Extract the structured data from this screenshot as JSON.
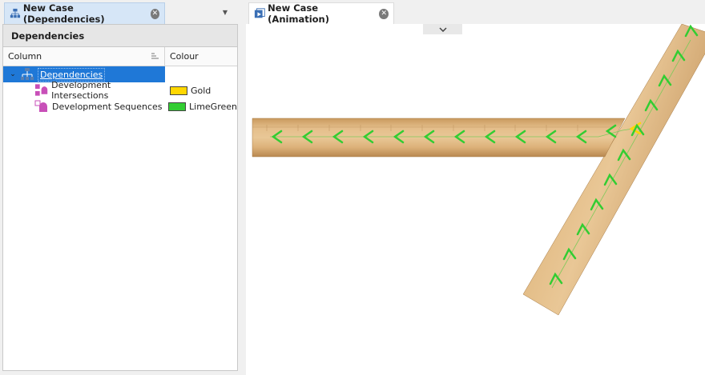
{
  "left_tab": {
    "title": "New Case (Dependencies)",
    "icon": "dependencies-tab-icon",
    "close_icon": "close-icon"
  },
  "right_tab": {
    "title": "New Case (Animation)",
    "icon": "animation-tab-icon",
    "close_icon": "close-icon"
  },
  "panel": {
    "title": "Dependencies",
    "columns": {
      "column": "Column",
      "colour": "Colour"
    },
    "rows": [
      {
        "label": "Dependencies",
        "colour_name": "",
        "icon": "hierarchy-icon",
        "selected": true,
        "expanded": true
      },
      {
        "label": "Development Intersections",
        "colour_name": "Gold",
        "colour_hex": "#FFD700",
        "icon": "intersection-dependency-icon"
      },
      {
        "label": "Development Sequences",
        "colour_name": "LimeGreen",
        "colour_hex": "#32CD32",
        "icon": "sequence-dependency-icon"
      }
    ]
  },
  "colors": {
    "accent": "#1f78d7",
    "tunnel": "#d8a86c",
    "sequence_arrow": "#32CD32",
    "intersection_arrow": "#FFD700"
  }
}
